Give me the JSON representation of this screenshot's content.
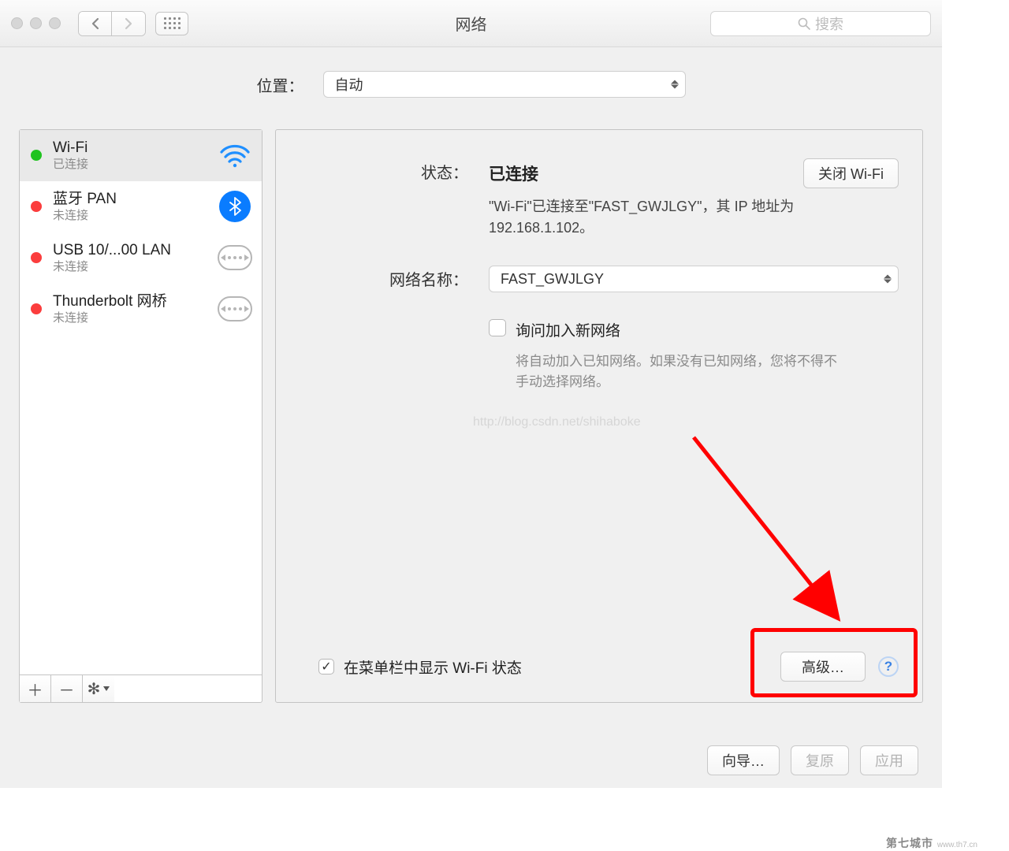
{
  "window": {
    "title": "网络",
    "search_placeholder": "搜索"
  },
  "location": {
    "label": "位置：",
    "value": "自动"
  },
  "sidebar": {
    "items": [
      {
        "name": "Wi-Fi",
        "sub": "已连接",
        "status": "green",
        "icon": "wifi",
        "selected": true
      },
      {
        "name": "蓝牙 PAN",
        "sub": "未连接",
        "status": "red",
        "icon": "bluetooth",
        "selected": false
      },
      {
        "name": "USB 10/...00 LAN",
        "sub": "未连接",
        "status": "red",
        "icon": "ethernet",
        "selected": false
      },
      {
        "name": "Thunderbolt 网桥",
        "sub": "未连接",
        "status": "red",
        "icon": "ethernet",
        "selected": false
      }
    ]
  },
  "main": {
    "status_label": "状态：",
    "status_value": "已连接",
    "wifi_off_btn": "关闭 Wi-Fi",
    "status_note": "\"Wi-Fi\"已连接至\"FAST_GWJLGY\"，其 IP 地址为 192.168.1.102。",
    "network_name_label": "网络名称：",
    "network_name_value": "FAST_GWJLGY",
    "ask_join_label": "询问加入新网络",
    "ask_join_sub": "将自动加入已知网络。如果没有已知网络，您将不得不手动选择网络。",
    "watermark": "http://blog.csdn.net/shihaboke",
    "show_in_menu_label": "在菜单栏中显示 Wi-Fi 状态",
    "advanced_btn": "高级…"
  },
  "footer": {
    "assist_btn": "向导…",
    "revert_btn": "复原",
    "apply_btn": "应用"
  },
  "page_watermark": "第七城市"
}
